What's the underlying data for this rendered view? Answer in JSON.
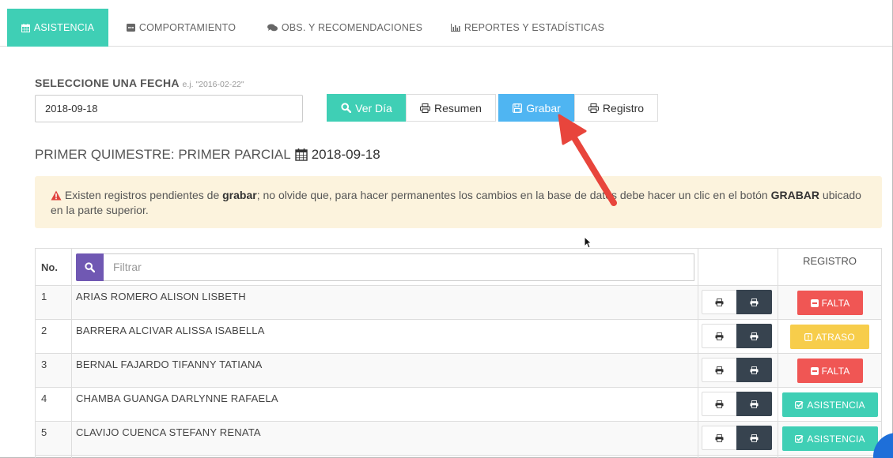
{
  "tabs": [
    {
      "label": "ASISTENCIA",
      "icon": "calendar-icon",
      "active": true
    },
    {
      "label": "COMPORTAMIENTO",
      "icon": "comment-box-icon",
      "active": false
    },
    {
      "label": "OBS. Y RECOMENDACIONES",
      "icon": "comments-icon",
      "active": false
    },
    {
      "label": "REPORTES Y ESTADÍSTICAS",
      "icon": "bar-chart-icon",
      "active": false
    }
  ],
  "date_picker": {
    "label": "SELECCIONE UNA FECHA",
    "hint": "e.j. \"2016-02-22\"",
    "value": "2018-09-18"
  },
  "toolbar": {
    "ver_dia_label": "Ver Día",
    "resumen_label": "Resumen",
    "grabar_label": "Grabar",
    "registro_label": "Registro"
  },
  "section": {
    "title": "PRIMER QUIMESTRE: PRIMER PARCIAL",
    "date": "2018-09-18"
  },
  "alert": {
    "text_1": "Existen registros pendientes de ",
    "bold_1": "grabar",
    "text_2": "; no olvide que, para hacer permanentes los cambios en la base de datos debe hacer un clic en el botón ",
    "bold_2": "GRABAR",
    "text_3": " ubicado en la parte superior."
  },
  "table": {
    "col_no": "No.",
    "filter_placeholder": "Filtrar",
    "col_registro": "REGISTRO",
    "rows": [
      {
        "no": "1",
        "name": "ARIAS ROMERO ALISON LISBETH",
        "status": "FALTA"
      },
      {
        "no": "2",
        "name": "BARRERA ALCIVAR ALISSA ISABELLA",
        "status": "ATRASO"
      },
      {
        "no": "3",
        "name": "BERNAL FAJARDO TIFANNY TATIANA",
        "status": "FALTA"
      },
      {
        "no": "4",
        "name": "CHAMBA GUANGA DARLYNNE RAFAELA",
        "status": "ASISTENCIA"
      },
      {
        "no": "5",
        "name": "CLAVIJO CUENCA STEFANY RENATA",
        "status": "ASISTENCIA"
      }
    ]
  },
  "colors": {
    "teal": "#3fcfb5",
    "blue": "#4fb5f2",
    "red": "#f05654",
    "yellow": "#f7cd4b",
    "dark": "#37434f",
    "purple": "#7058b3",
    "alert_bg": "#fcf3dd",
    "arrow": "#e8453c"
  }
}
